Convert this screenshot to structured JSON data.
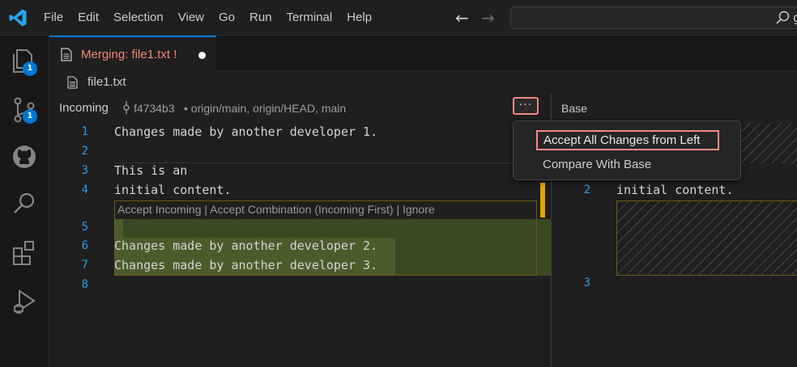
{
  "menu": [
    "File",
    "Edit",
    "Selection",
    "View",
    "Go",
    "Run",
    "Terminal",
    "Help"
  ],
  "command_center": {
    "text": "g"
  },
  "activity": {
    "explorer_badge": "1",
    "scm_badge": "1"
  },
  "tab": {
    "label": "Merging: file1.txt !"
  },
  "breadcrumb": {
    "file": "file1.txt"
  },
  "incoming": {
    "title": "Incoming",
    "commit": "f4734b3",
    "refs": "• origin/main, origin/HEAD, main",
    "more": "···",
    "codelens": "Accept Incoming | Accept Combination (Incoming First) | Ignore",
    "lines": [
      {
        "n": "1",
        "text": "Changes made by another developer 1."
      },
      {
        "n": "2",
        "text": ""
      },
      {
        "n": "3",
        "text": "This is an"
      },
      {
        "n": "4",
        "text": "initial content."
      },
      {
        "n": "5",
        "text": ""
      },
      {
        "n": "6",
        "text": "Changes made by another developer 2."
      },
      {
        "n": "7",
        "text": "Changes made by another developer 3."
      },
      {
        "n": "8",
        "text": ""
      }
    ]
  },
  "base": {
    "title": "Base",
    "lines": [
      {
        "n": "2",
        "text": "initial content."
      },
      {
        "n": "3",
        "text": ""
      }
    ]
  },
  "context_menu": {
    "items": [
      "Accept All Changes from Left",
      "Compare With Base"
    ]
  },
  "colors": {
    "accent": "#0078d4",
    "highlight": "#f28b82",
    "warning_label": "#f48771"
  }
}
